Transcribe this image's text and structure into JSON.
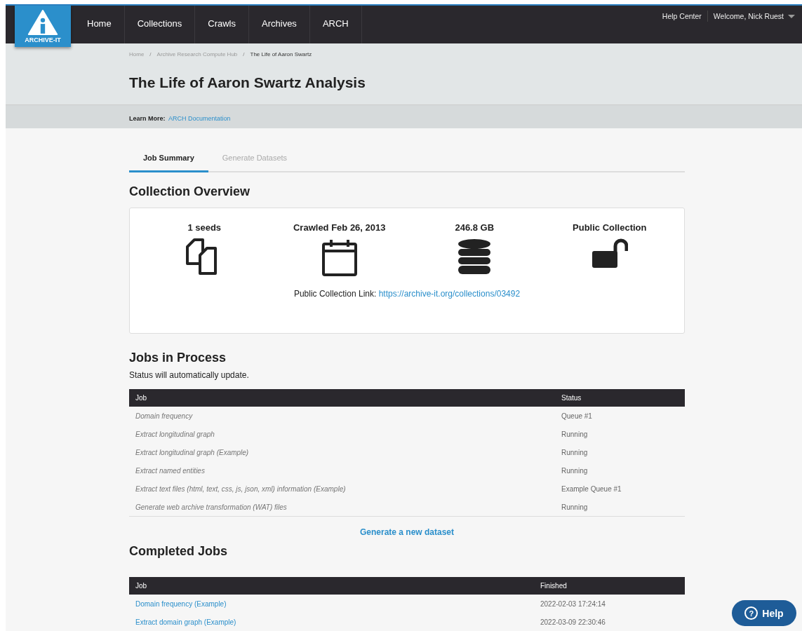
{
  "logo": {
    "text": "ARCHIVE-IT"
  },
  "nav": [
    "Home",
    "Collections",
    "Crawls",
    "Archives",
    "ARCH"
  ],
  "user_menu": {
    "help": "Help Center",
    "welcome": "Welcome, Nick Ruest"
  },
  "breadcrumb_separator": "/",
  "breadcrumb": [
    "Home",
    "Archive Research Compute Hub",
    "The Life of Aaron Swartz"
  ],
  "title": "The Life of Aaron Swartz Analysis",
  "learn_more": {
    "label": "Learn More:",
    "link": "ARCH Documentation"
  },
  "tabs": [
    {
      "label": "Job Summary",
      "selected": true
    },
    {
      "label": "Generate Datasets",
      "selected": false
    }
  ],
  "overview": {
    "heading": "Collection Overview",
    "stats": [
      {
        "label": "1 seeds",
        "kind": "seeds"
      },
      {
        "label": "Crawled Feb 26, 2013",
        "kind": "date"
      },
      {
        "label": "246.8 GB",
        "kind": "size"
      },
      {
        "label": "Public Collection",
        "kind": "access"
      }
    ],
    "link_label": "Public Collection Link:",
    "link": "https://archive-it.org/collections/03492"
  },
  "in_process": {
    "heading": "Jobs in Process",
    "note": "Status will automatically update.",
    "columns": [
      "Job",
      "Status"
    ],
    "rows": [
      {
        "job": "Domain frequency",
        "status": "Queue #1"
      },
      {
        "job": "Extract longitudinal graph",
        "status": "Running"
      },
      {
        "job": "Extract longitudinal graph (Example)",
        "status": "Running"
      },
      {
        "job": "Extract named entities",
        "status": "Running"
      },
      {
        "job": "Extract text files (html, text, css, js, json, xml) information (Example)",
        "status": "Example Queue #1"
      },
      {
        "job": "Generate web archive transformation (WAT) files",
        "status": "Running"
      }
    ]
  },
  "generate_link": "Generate a new dataset",
  "completed": {
    "heading": "Completed Jobs",
    "columns": [
      "Job",
      "Finished"
    ],
    "rows": [
      {
        "job": "Domain frequency (Example)",
        "finished": "2022-02-03 17:24:14"
      },
      {
        "job": "Extract domain graph (Example)",
        "finished": "2022-03-09 22:30:46"
      }
    ]
  },
  "help_button": {
    "icon": "?",
    "label": "Help"
  }
}
